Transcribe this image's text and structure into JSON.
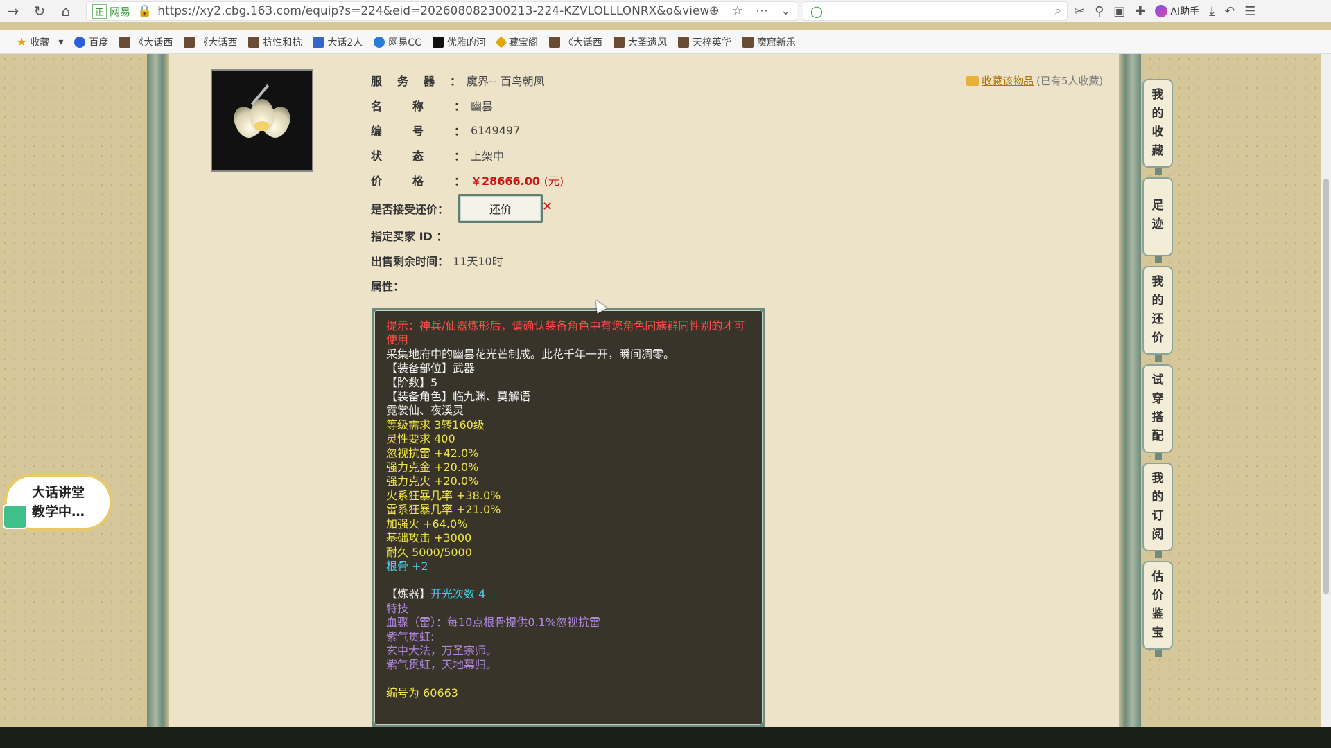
{
  "browser": {
    "url": "https://xy2.cbg.163.com/equip?s=224&eid=202608082300213-224-KZVLOLLLONRX&o&view",
    "site_badge": "网易",
    "ai_helper": "AI助手"
  },
  "bookmarks": [
    {
      "label": "收藏",
      "icon": "star-icon"
    },
    {
      "label": "百度",
      "icon": "paw-icon"
    },
    {
      "label": "《大话西",
      "icon": "game-icon"
    },
    {
      "label": "《大话西",
      "icon": "game-icon"
    },
    {
      "label": "抗性和抗",
      "icon": "game-icon"
    },
    {
      "label": "大话2人",
      "icon": "ww-icon"
    },
    {
      "label": "网易CC",
      "icon": "cc-icon"
    },
    {
      "label": "优雅的河",
      "icon": "tiktok-icon"
    },
    {
      "label": "藏宝阁",
      "icon": "gold-icon"
    },
    {
      "label": "《大话西",
      "icon": "game-icon"
    },
    {
      "label": "大圣遗风",
      "icon": "game-icon"
    },
    {
      "label": "天梓英华",
      "icon": "game-icon"
    },
    {
      "label": "魔窟新乐",
      "icon": "game-icon"
    }
  ],
  "item": {
    "server_label": "服务器：",
    "server": "魔界-- 百鸟朝凤",
    "name_label": "名称：",
    "name": "幽昙",
    "id_label": "编号：",
    "id": "6149497",
    "status_label": "状态：",
    "status": "上架中",
    "price_label": "价格：",
    "price": "￥28666.00",
    "price_unit": "(元)",
    "bargain_label": "是否接受还价：",
    "bargain_button": "还价",
    "buyer_label": "指定买家 ID ：",
    "remaining_label": "出售剩余时间：",
    "remaining": "11天10时",
    "attr_label": "属性："
  },
  "collect": {
    "link": "收藏该物品",
    "count": "(已有5人收藏)"
  },
  "tooltip": {
    "warning": "提示：神兵/仙器炼形后，请确认装备角色中有您角色同族群同性别的才可使用",
    "desc": "采集地府中的幽昙花光芒制成。此花千年一开，瞬间凋零。",
    "part": "【装备部位】武器",
    "tier": "【阶数】5",
    "roles1": "【装备角色】临九渊、莫解语",
    "roles2": "霓裳仙、夜溪灵",
    "level_req": "等级需求 3转160级",
    "spirit_req": "灵性要求 400",
    "stats": [
      "忽视抗雷 +42.0%",
      "强力克金 +20.0%",
      "强力克火 +20.0%",
      "火系狂暴几率 +38.0%",
      "雷系狂暴几率 +21.0%",
      "加强火 +64.0%",
      "基础攻击 +3000",
      "耐久 5000/5000"
    ],
    "bone": "根骨 +2",
    "refine_label": "【炼器】",
    "refine_value": "开光次数 4",
    "skill_title": "特技",
    "skill_line": "血骤（雷）：每10点根骨提供0.1%忽视抗雷",
    "purple_title": "紫气贯虹:",
    "purple_1": "玄中大法，万圣宗师。",
    "purple_2": "紫气贯虹，天地幕归。",
    "code": "编号为 60663"
  },
  "side_tabs": [
    [
      "我",
      "的",
      "收",
      "藏"
    ],
    [
      "足",
      "迹"
    ],
    [
      "我",
      "的",
      "还",
      "价"
    ],
    [
      "试",
      "穿",
      "搭",
      "配"
    ],
    [
      "我",
      "的",
      "订",
      "阅"
    ],
    [
      "估",
      "价",
      "鉴",
      "宝"
    ]
  ],
  "teach": {
    "line1": "大话讲堂",
    "line2": "教学中…"
  }
}
